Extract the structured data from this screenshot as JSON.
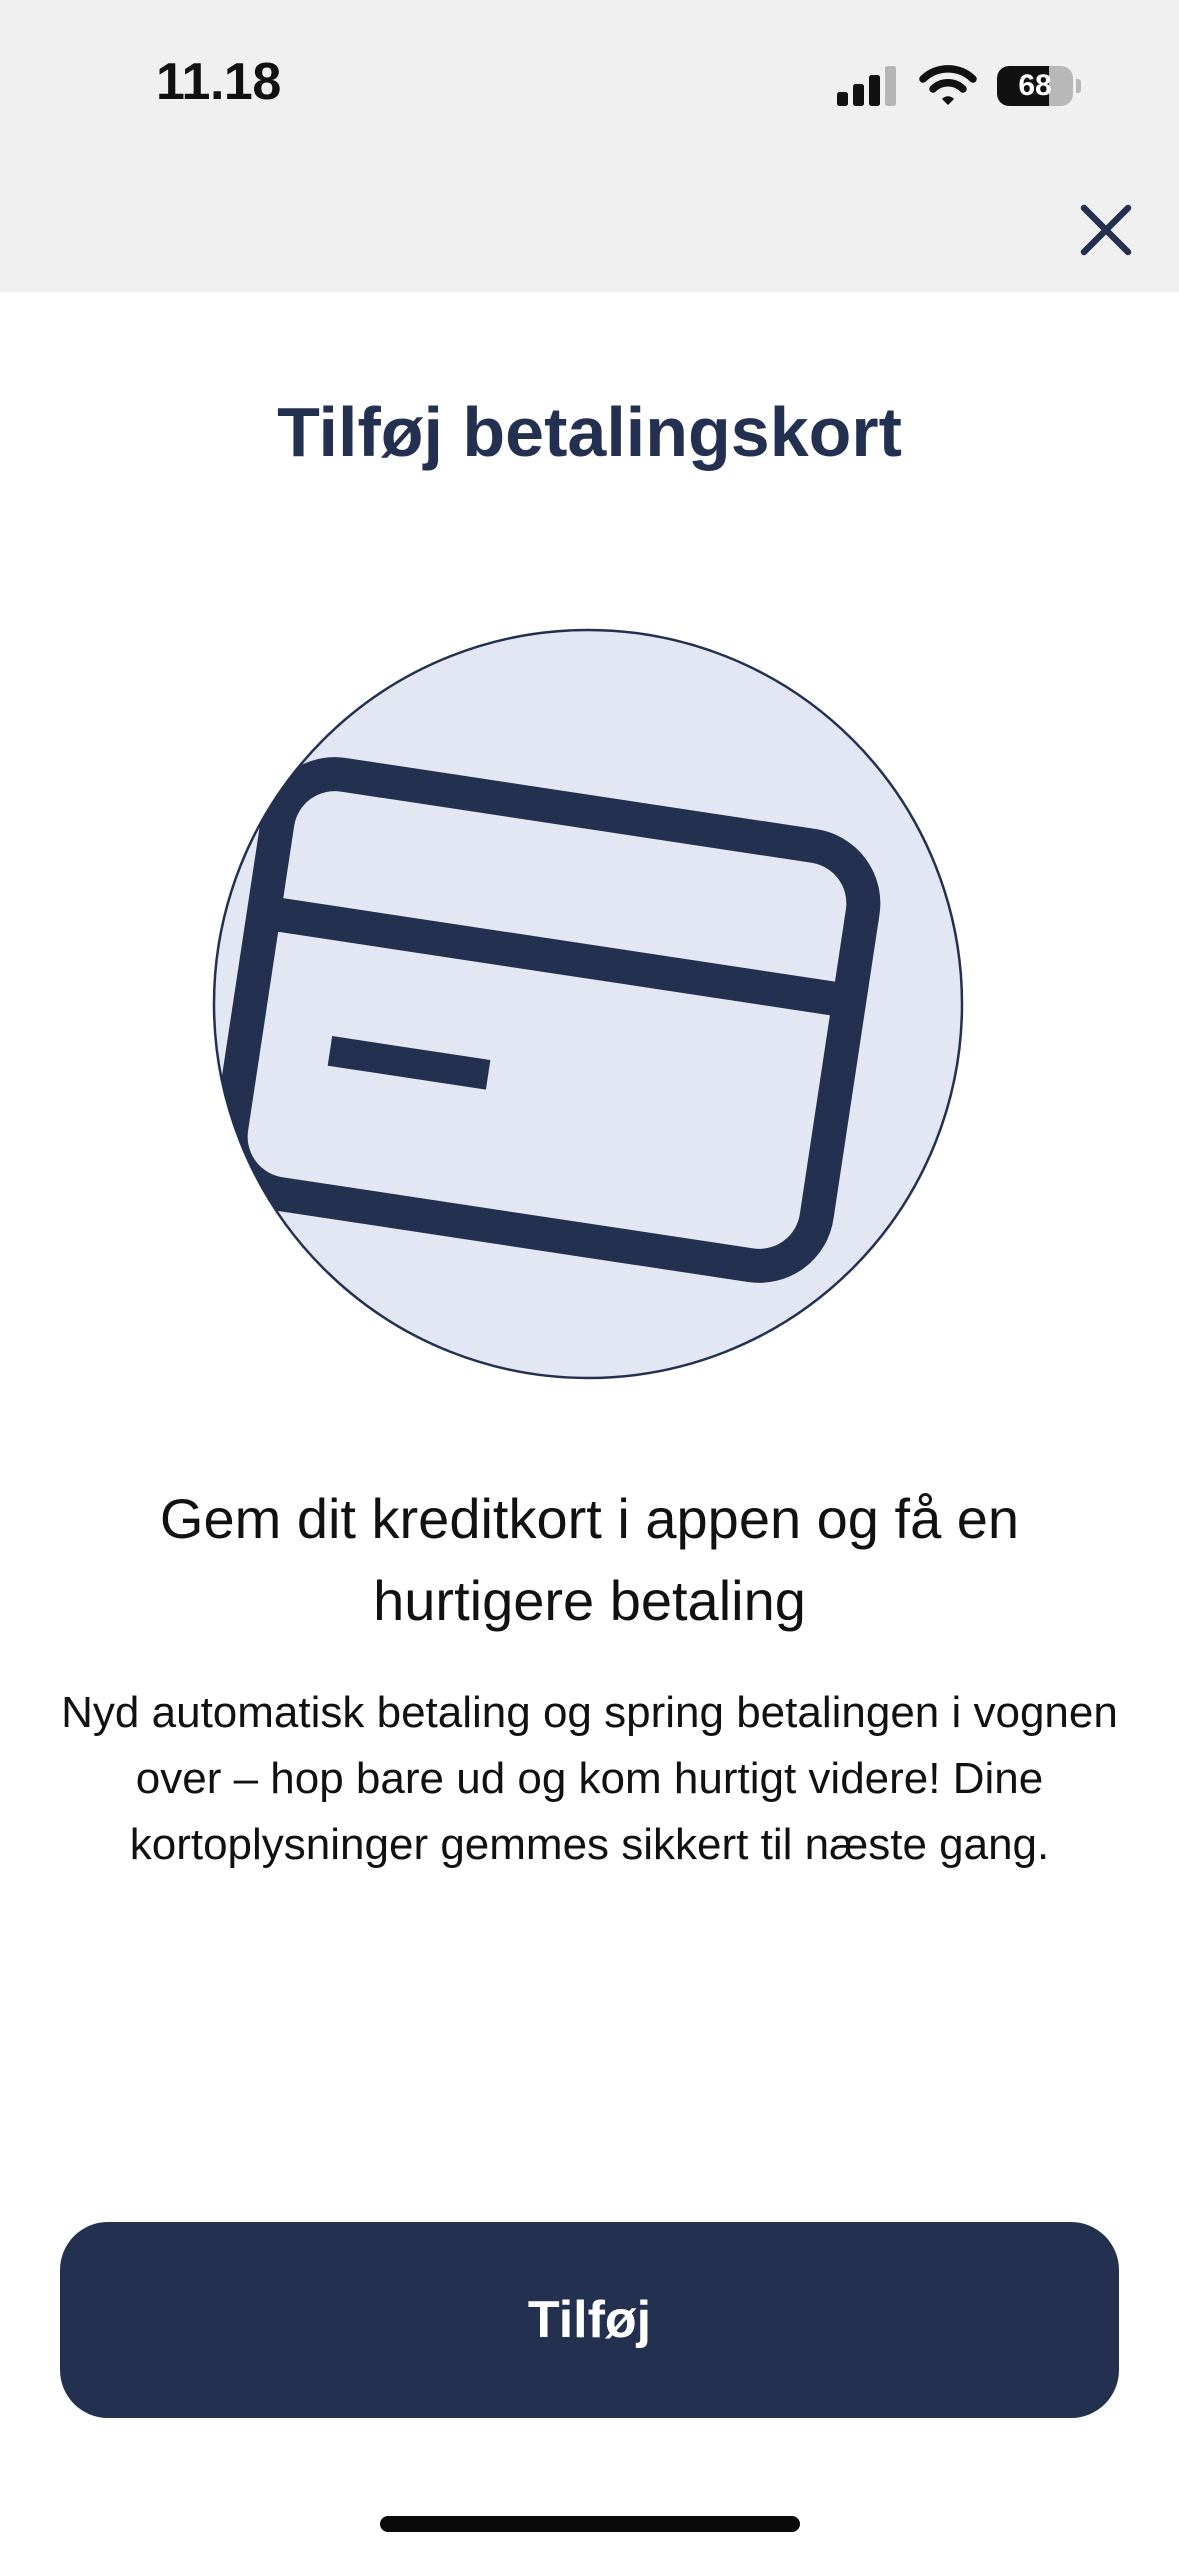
{
  "status_bar": {
    "time": "11.18",
    "battery_level": "68",
    "icons": [
      "signal-icon",
      "wifi-icon",
      "battery-icon"
    ]
  },
  "header": {
    "close_icon": "close-icon"
  },
  "main": {
    "title": "Tilføj betalingskort",
    "illustration_icon": "credit-card-icon",
    "headline": "Gem dit kreditkort i appen og få en hurtigere betaling",
    "body": "Nyd automatisk betaling og spring betalingen i vognen over – hop bare ud og kom hurtigt videre! Dine kortoplysninger gemmes sikkert til næste gang."
  },
  "actions": {
    "primary_label": "Tilføj"
  },
  "colors": {
    "primary": "#23304f",
    "circle_fill": "#e3e7f3",
    "sheet_background": "#f0f0f0"
  }
}
